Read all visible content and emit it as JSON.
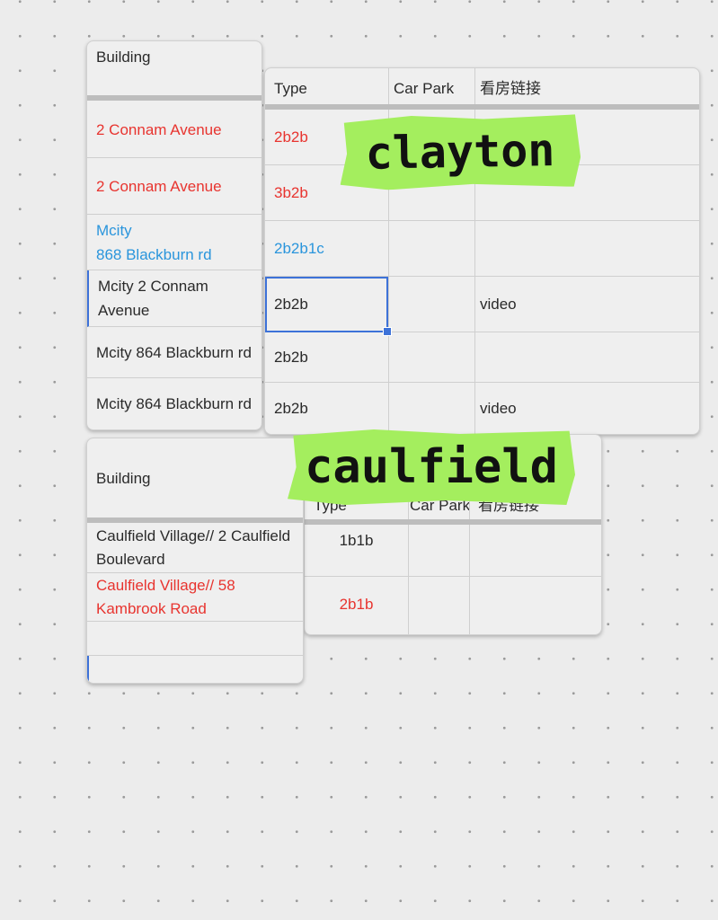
{
  "clayton": {
    "label": "clayton",
    "building_header": "Building",
    "headers": [
      "Type",
      "Car Park",
      "看房链接"
    ],
    "rows": [
      {
        "building": "2 Connam Avenue",
        "type": "2b2b",
        "car_park": "",
        "link": "",
        "color": "#e8342f"
      },
      {
        "building": "2 Connam Avenue",
        "type": "3b2b",
        "car_park": "",
        "link": "",
        "color": "#e8342f"
      },
      {
        "building": "Mcity\n868 Blackburn rd",
        "type": "2b2b1c",
        "car_park": "",
        "link": "",
        "color": "#2a95dc"
      },
      {
        "building": "Mcity 2 Connam Avenue",
        "type": "2b2b",
        "car_park": "",
        "link": "video",
        "color": "#2a2a2a",
        "selected": true
      },
      {
        "building": "Mcity 864 Blackburn rd",
        "type": "2b2b",
        "car_park": "",
        "link": "",
        "color": "#2a2a2a"
      },
      {
        "building": "Mcity 864 Blackburn rd",
        "type": "2b2b",
        "car_park": "",
        "link": "video",
        "color": "#2a2a2a"
      }
    ]
  },
  "caulfield": {
    "label": "caulfield",
    "building_header": "Building",
    "headers": [
      "Type",
      "Car Park",
      "看房链接"
    ],
    "rows": [
      {
        "building": "Caulfield Village// 2 Caulfield Boulevard",
        "type": "1b1b",
        "color": "#2a2a2a"
      },
      {
        "building": "Caulfield Village// 58 Kambrook Road",
        "type": "2b1b",
        "color": "#e8342f"
      },
      {
        "building": "",
        "type": ""
      },
      {
        "building": "",
        "type": ""
      }
    ]
  },
  "colors": {
    "sticker": "#a4ee5e",
    "selection": "#3d72d8"
  }
}
